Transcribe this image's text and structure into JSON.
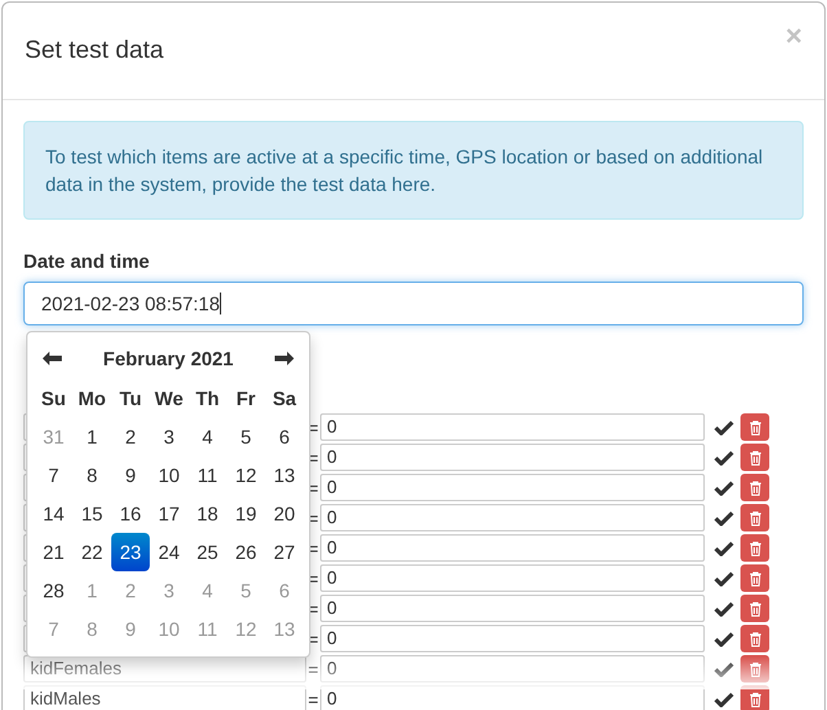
{
  "dialog": {
    "title": "Set test data",
    "close": "×"
  },
  "info": "To test which items are active at a specific time, GPS location or based on additional data in the system, provide the test data here.",
  "datetime": {
    "label": "Date and time",
    "value": "2021-02-23 08:57:18"
  },
  "calendar": {
    "month": "February 2021",
    "weekdays": [
      "Su",
      "Mo",
      "Tu",
      "We",
      "Th",
      "Fr",
      "Sa"
    ],
    "weeks": [
      [
        {
          "day": "31",
          "other_month": true,
          "selected": false
        },
        {
          "day": "1",
          "other_month": false,
          "selected": false
        },
        {
          "day": "2",
          "other_month": false,
          "selected": false
        },
        {
          "day": "3",
          "other_month": false,
          "selected": false
        },
        {
          "day": "4",
          "other_month": false,
          "selected": false
        },
        {
          "day": "5",
          "other_month": false,
          "selected": false
        },
        {
          "day": "6",
          "other_month": false,
          "selected": false
        }
      ],
      [
        {
          "day": "7",
          "other_month": false,
          "selected": false
        },
        {
          "day": "8",
          "other_month": false,
          "selected": false
        },
        {
          "day": "9",
          "other_month": false,
          "selected": false
        },
        {
          "day": "10",
          "other_month": false,
          "selected": false
        },
        {
          "day": "11",
          "other_month": false,
          "selected": false
        },
        {
          "day": "12",
          "other_month": false,
          "selected": false
        },
        {
          "day": "13",
          "other_month": false,
          "selected": false
        }
      ],
      [
        {
          "day": "14",
          "other_month": false,
          "selected": false
        },
        {
          "day": "15",
          "other_month": false,
          "selected": false
        },
        {
          "day": "16",
          "other_month": false,
          "selected": false
        },
        {
          "day": "17",
          "other_month": false,
          "selected": false
        },
        {
          "day": "18",
          "other_month": false,
          "selected": false
        },
        {
          "day": "19",
          "other_month": false,
          "selected": false
        },
        {
          "day": "20",
          "other_month": false,
          "selected": false
        }
      ],
      [
        {
          "day": "21",
          "other_month": false,
          "selected": false
        },
        {
          "day": "22",
          "other_month": false,
          "selected": false
        },
        {
          "day": "23",
          "other_month": false,
          "selected": true
        },
        {
          "day": "24",
          "other_month": false,
          "selected": false
        },
        {
          "day": "25",
          "other_month": false,
          "selected": false
        },
        {
          "day": "26",
          "other_month": false,
          "selected": false
        },
        {
          "day": "27",
          "other_month": false,
          "selected": false
        }
      ],
      [
        {
          "day": "28",
          "other_month": false,
          "selected": false
        },
        {
          "day": "1",
          "other_month": true,
          "selected": false
        },
        {
          "day": "2",
          "other_month": true,
          "selected": false
        },
        {
          "day": "3",
          "other_month": true,
          "selected": false
        },
        {
          "day": "4",
          "other_month": true,
          "selected": false
        },
        {
          "day": "5",
          "other_month": true,
          "selected": false
        },
        {
          "day": "6",
          "other_month": true,
          "selected": false
        }
      ],
      [
        {
          "day": "7",
          "other_month": true,
          "selected": false
        },
        {
          "day": "8",
          "other_month": true,
          "selected": false
        },
        {
          "day": "9",
          "other_month": true,
          "selected": false
        },
        {
          "day": "10",
          "other_month": true,
          "selected": false
        },
        {
          "day": "11",
          "other_month": true,
          "selected": false
        },
        {
          "day": "12",
          "other_month": true,
          "selected": false
        },
        {
          "day": "13",
          "other_month": true,
          "selected": false
        }
      ]
    ]
  },
  "rows": [
    {
      "operator": "=",
      "value": "0"
    },
    {
      "operator": "=",
      "value": "0"
    },
    {
      "operator": "=",
      "value": "0"
    },
    {
      "operator": "=",
      "value": "0"
    },
    {
      "operator": "=",
      "value": "0"
    },
    {
      "operator": "=",
      "value": "0"
    },
    {
      "operator": "=",
      "value": "0"
    },
    {
      "operator": "=",
      "value": "0"
    },
    {
      "name": "kidFemales",
      "operator": "=",
      "value": "0"
    },
    {
      "name": "kidMales",
      "operator": "=",
      "value": "0"
    }
  ]
}
